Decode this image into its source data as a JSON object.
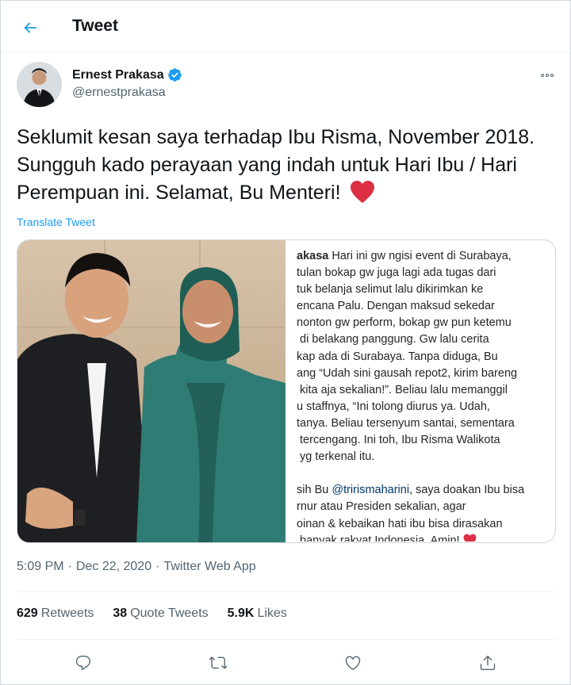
{
  "header": {
    "title": "Tweet",
    "back_icon": "arrow-left-icon"
  },
  "author": {
    "name": "Ernest Prakasa",
    "handle": "@ernestprakasa",
    "verified_icon": "verified-badge-icon",
    "accent_color": "#1d9bf0"
  },
  "tweet": {
    "text": "Seklumit kesan saya terhadap Ibu Risma, November 2018. Sungguh kado perayaan yang indah untuk Hari Ibu / Hari Perempuan ini. Selamat, Bu Menteri!",
    "emoji": "red-heart-icon",
    "translate_label": "Translate Tweet"
  },
  "media": {
    "caption_handle": "akasa",
    "caption_lines": [
      " Hari ini gw ngisi event di Surabaya,",
      "tulan bokap gw juga lagi ada tugas dari",
      "tuk belanja selimut lalu dikirimkan ke",
      "encana Palu. Dengan maksud sekedar",
      "nonton gw perform, bokap gw pun ketemu",
      " di belakang panggung. Gw lalu cerita",
      "kap ada di Surabaya. Tanpa diduga, Bu",
      "ang “Udah sini gausah repot2, kirim bareng",
      " kita aja sekalian!”. Beliau lalu memanggil",
      "u staffnya, “Ini tolong diurus ya. Udah,",
      "tanya. Beliau tersenyum santai, sementara",
      " tercengang. Ini toh, Ibu Risma Walikota",
      " yg terkenal itu.",
      "",
      "sih Bu ",
      "rnur atau Presiden sekalian, agar",
      "oinan & kebaikan hati ibu bisa dirasakan",
      " banyak rakyat Indonesia. Amin! "
    ],
    "caption_mention": "@trirismaharini",
    "caption_mention_tail": ", saya doakan Ibu bisa"
  },
  "meta": {
    "time": "5:09 PM",
    "separator1": "·",
    "date": "Dec 22, 2020",
    "separator2": "·",
    "source": "Twitter Web App"
  },
  "stats": {
    "retweets_count": "629",
    "retweets_label": "Retweets",
    "quotes_count": "38",
    "quotes_label": "Quote Tweets",
    "likes_count": "5.9K",
    "likes_label": "Likes"
  },
  "actions": [
    "reply-icon",
    "retweet-icon",
    "like-icon",
    "share-icon"
  ]
}
